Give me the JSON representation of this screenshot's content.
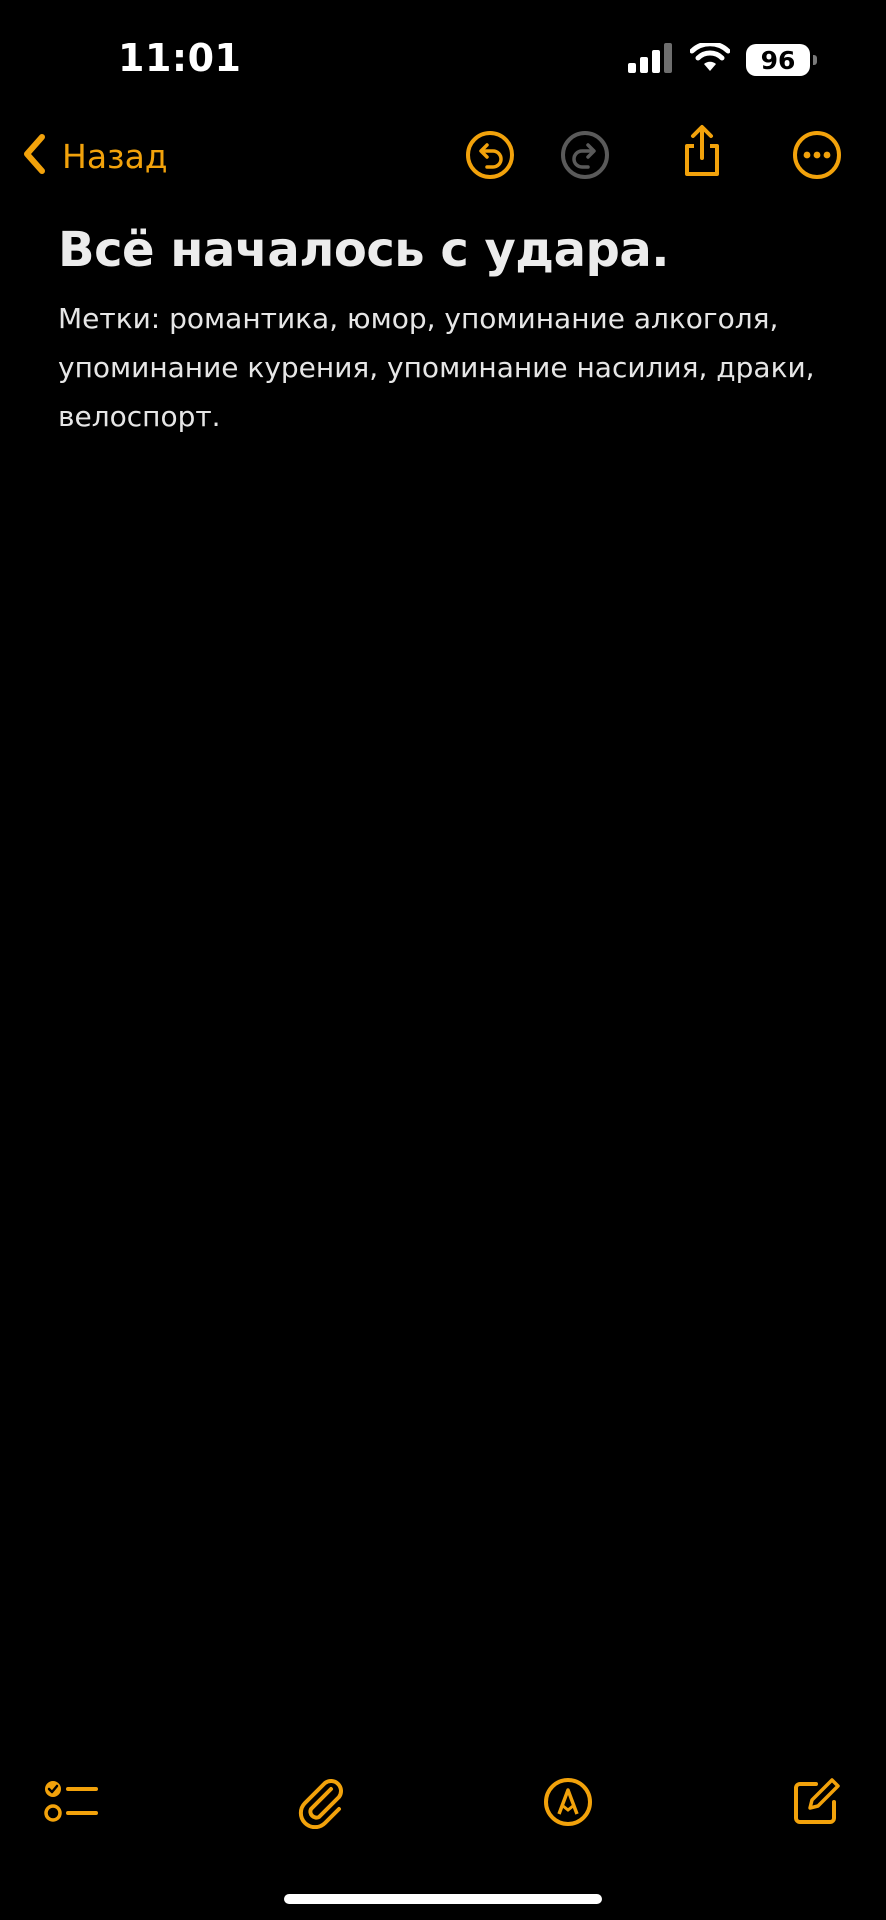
{
  "status_bar": {
    "time": "11:01",
    "battery": "96",
    "icons": [
      "cellular-signal-icon",
      "wifi-icon",
      "battery-icon"
    ]
  },
  "nav": {
    "back_label": "Назад",
    "icons": [
      "undo-icon",
      "redo-icon",
      "share-icon",
      "more-icon"
    ]
  },
  "note": {
    "title": "Всё началось с удара.",
    "body": "Метки: романтика, юмор, упоминание алкоголя, упоминание курения, упоминание насилия, драки, велоспорт."
  },
  "toolbar": {
    "icons": [
      "checklist-icon",
      "attachment-icon",
      "markup-icon",
      "compose-icon"
    ]
  },
  "colors": {
    "accent": "#f2a20b",
    "background": "#000000",
    "disabled": "#5a5a5a",
    "text": "#ececec"
  }
}
